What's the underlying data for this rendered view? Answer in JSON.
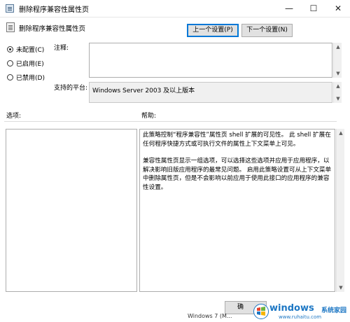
{
  "window": {
    "title": "删除程序兼容性属性页",
    "controls": [
      "minimize-icon",
      "maximize-icon",
      "close-icon"
    ],
    "minimize_glyph": "—",
    "maximize_glyph": "☐",
    "close_glyph": "✕"
  },
  "header": {
    "title": "删除程序兼容性属性页",
    "prev_button": "上一个设置(P)",
    "next_button": "下一个设置(N)"
  },
  "state_options": [
    {
      "label": "未配置(C)",
      "selected": true
    },
    {
      "label": "已启用(E)",
      "selected": false
    },
    {
      "label": "已禁用(D)",
      "selected": false
    }
  ],
  "comment": {
    "label": "注释:",
    "value": ""
  },
  "platform": {
    "label": "支持的平台:",
    "value": "Windows Server 2003 及以上版本"
  },
  "sections": {
    "options_label": "选项:",
    "help_label": "帮助:"
  },
  "help_text": {
    "p1": "此策略控制“程序兼容性”属性页 shell 扩展的可见性。 此 shell 扩展在任何程序快捷方式或可执行文件的属性上下文菜单上可见。",
    "p2": "兼容性属性页显示一组选项，可以选择这些选项并应用于应用程序，以解决影响旧版应用程序的最常见问题。 启用此策略设置可从上下文菜单中删除属性页，但是不会影响以前应用于使用此接口的应用程序的兼容性设置。"
  },
  "footer": {
    "ok_button_partial": "确"
  },
  "watermark": {
    "brand": "windows",
    "brand_cn": "系统家园",
    "url": "www.ruhaitu.com",
    "colors": {
      "brand": "#1d77c4",
      "logo_red": "#e8412c",
      "logo_green": "#6cb33e",
      "logo_blue": "#1d77c4",
      "logo_yellow": "#f5b400"
    }
  },
  "background_text": "Windows 7 (M..."
}
